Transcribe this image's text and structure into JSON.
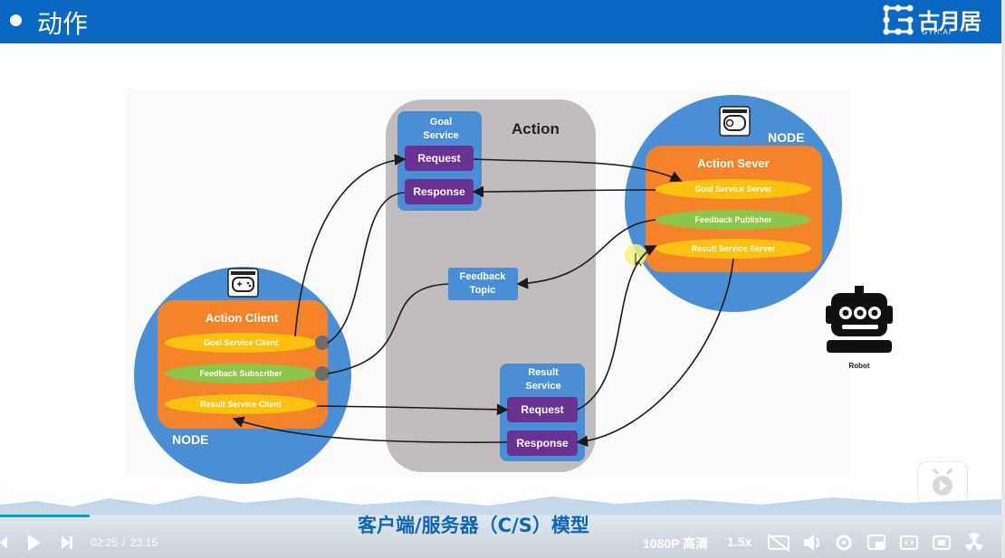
{
  "header": {
    "title": "动作",
    "logo_text": "古月居",
    "logo_sub": "GYH.AI"
  },
  "diagram": {
    "action_title": "Action",
    "goal_service_title": "Goal\nService",
    "goal_request": "Request",
    "goal_response": "Response",
    "result_service_title": "Result\nService",
    "result_request": "Request",
    "result_response": "Response",
    "feedback_topic": "Feedback\nTopic",
    "client_node_label": "NODE",
    "server_node_label": "NODE",
    "action_client": "Action Client",
    "goal_service_client": "Goal Service Client",
    "feedback_subscriber": "Feedback Subscriber",
    "result_service_client": "Result Service Client",
    "action_server": "Action Sever",
    "goal_service_server": "Goal Service Server",
    "feedback_publisher": "Feedback Publisher",
    "result_service_server": "Result Service Server",
    "robot_label": "Robot"
  },
  "subtitle": "客户端/服务器（C/S）模型",
  "player": {
    "current_time": "02:25",
    "separator": "/",
    "total_time": "23:15",
    "quality": "1080P 高清",
    "speed": "1.5x",
    "progress": 0.104
  },
  "colors": {
    "header_blue": "#0a68c2",
    "node_blue": "#4a8fd6",
    "orange": "#f5832a",
    "yellow": "#fdc20f",
    "green": "#8dc44a",
    "purple": "#6a3293",
    "action_gray": "#c1bcbd"
  }
}
